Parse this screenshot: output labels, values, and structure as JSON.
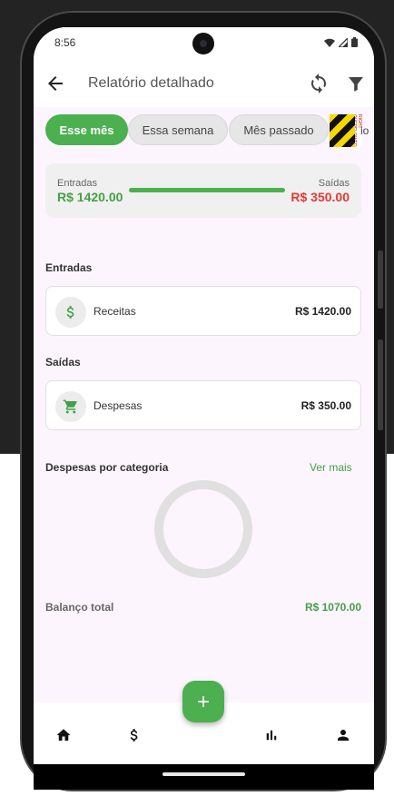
{
  "status_bar": {
    "time": "8:56"
  },
  "app_bar": {
    "title": "Relatório detalhado"
  },
  "filters": {
    "chips": [
      {
        "label": "Esse mês",
        "selected": true
      },
      {
        "label": "Essa semana",
        "selected": false
      },
      {
        "label": "Mês passado",
        "selected": false
      }
    ],
    "partial_chip": "io",
    "overflow_warning": "RIGHT OVERFLOWED BY 30 PIXELS"
  },
  "summary": {
    "income_label": "Entradas",
    "income_value": "R$ 1420.00",
    "expense_label": "Saídas",
    "expense_value": "R$ 350.00"
  },
  "income_section": {
    "title": "Entradas",
    "item": {
      "label": "Receitas",
      "value": "R$ 1420.00",
      "icon": "dollar-icon"
    }
  },
  "expense_section": {
    "title": "Saídas",
    "item": {
      "label": "Despesas",
      "value": "R$ 350.00",
      "icon": "cart-icon"
    }
  },
  "category_section": {
    "title": "Despesas por categoria",
    "see_more": "Ver mais"
  },
  "balance": {
    "label": "Balanço total",
    "value": "R$ 1070.00"
  },
  "colors": {
    "accent": "#4caf50",
    "income": "#43a047",
    "expense": "#e53935",
    "background": "#fdf5fd"
  },
  "bottom_nav": {
    "items": [
      {
        "icon": "home-icon"
      },
      {
        "icon": "dollar-icon"
      },
      {
        "icon": "bar-chart-icon"
      },
      {
        "icon": "person-icon"
      }
    ]
  },
  "fab": {
    "icon": "plus-icon"
  }
}
